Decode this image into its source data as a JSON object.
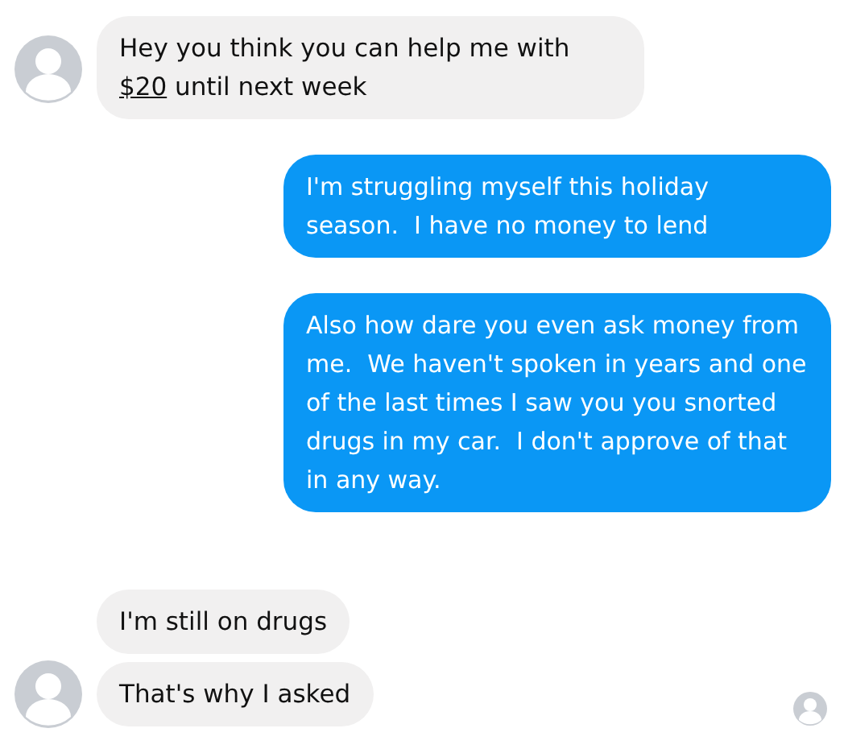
{
  "groups": [
    {
      "kind": "incoming",
      "messages": [
        {
          "parts": [
            {
              "kind": "text",
              "text": "Hey you think you can help me with "
            },
            {
              "kind": "link",
              "text": "$20"
            },
            {
              "kind": "text",
              "text": " until next week"
            }
          ]
        }
      ]
    },
    {
      "kind": "outgoing",
      "messages": [
        {
          "parts": [
            {
              "kind": "text",
              "text": "I'm struggling myself this holiday season.  I have no money to lend"
            }
          ]
        },
        {
          "parts": [
            {
              "kind": "text",
              "text": "Also how dare you even ask money from me.  We haven't spoken in years and one of the last times I saw you you snorted drugs in my car.  I don't approve of that in any way."
            }
          ]
        }
      ]
    },
    {
      "kind": "incoming",
      "messages": [
        {
          "parts": [
            {
              "kind": "text",
              "text": "I'm still on drugs"
            }
          ]
        },
        {
          "parts": [
            {
              "kind": "text",
              "text": "That's why I asked"
            }
          ]
        }
      ]
    }
  ],
  "read_receipt": true
}
